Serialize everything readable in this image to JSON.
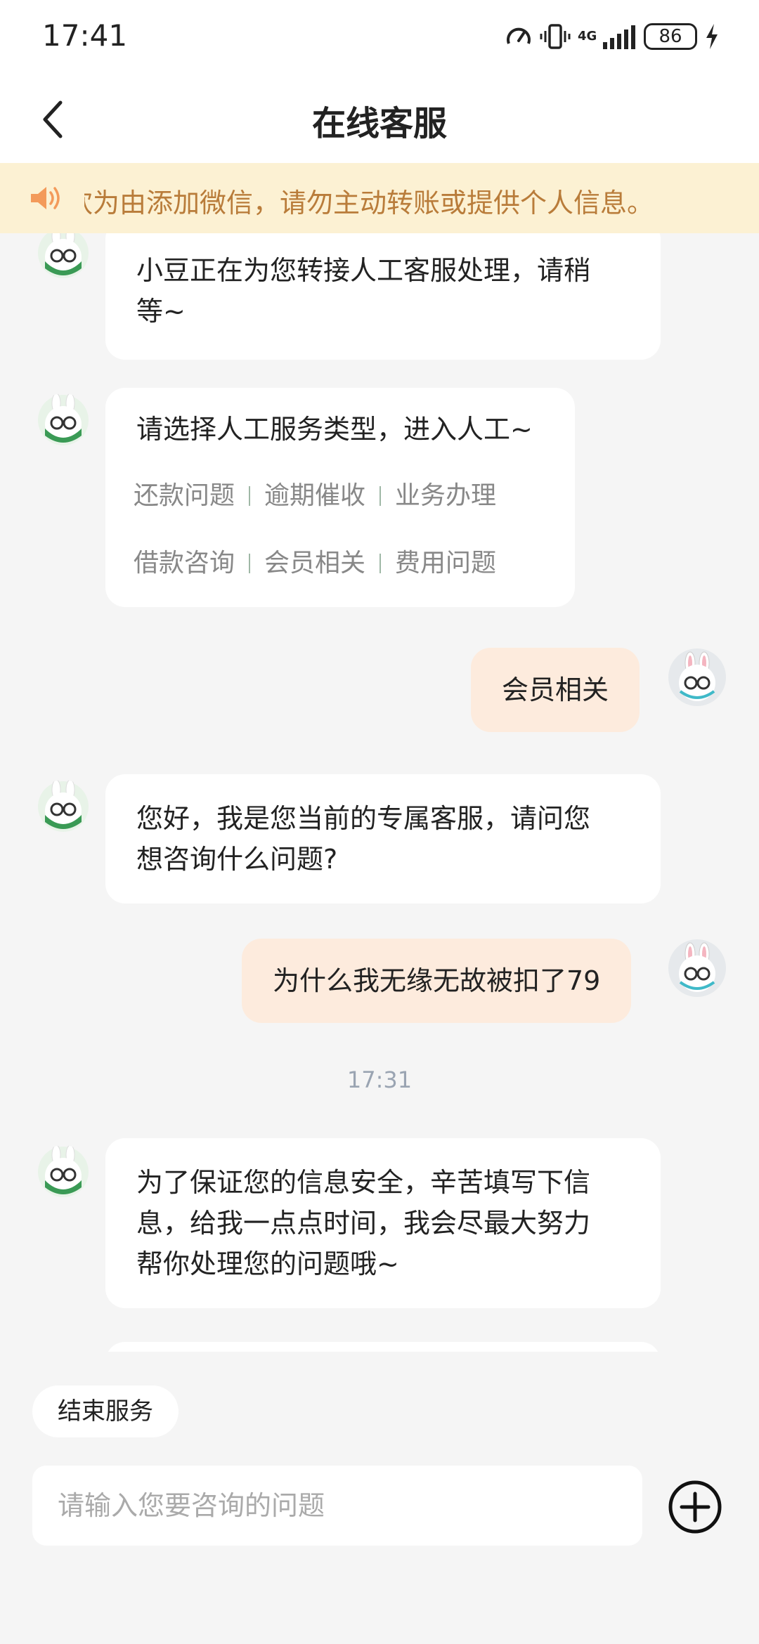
{
  "status_bar": {
    "time": "17:41",
    "battery": "86",
    "network": "4G",
    "icons": [
      "speed-icon",
      "vibrate-icon",
      "signal-icon",
      "battery-icon",
      "charging-icon"
    ]
  },
  "header": {
    "title": "在线客服",
    "back_icon": "chevron-left-icon"
  },
  "notice": {
    "icon": "speaker-icon",
    "text": "欢为由添加微信，请勿主动转账或提供个人信息。"
  },
  "messages": [
    {
      "sender": "agent",
      "text": "小豆正在为您转接人工客服处理，请稍\n等~"
    },
    {
      "sender": "agent",
      "text": "请选择人工服务类型，进入人工~",
      "options": [
        [
          "还款问题",
          "逾期催收",
          "业务办理"
        ],
        [
          "借款咨询",
          "会员相关",
          "费用问题"
        ]
      ]
    },
    {
      "sender": "user",
      "text": "会员相关"
    },
    {
      "sender": "agent",
      "text": "您好，我是您当前的专属客服，请问您\n想咨询什么问题?"
    },
    {
      "sender": "user",
      "text": "为什么我无缘无故被扣了79"
    },
    {
      "timestamp": "17:31"
    },
    {
      "sender": "agent",
      "text": "为了保证您的信息安全，辛苦填写下信\n息，给我一点点时间，我会尽最大努力\n帮你处理您的问题哦~"
    }
  ],
  "footer": {
    "end_service_label": "结束服务",
    "input_placeholder": "请输入您要咨询的问题",
    "plus_icon": "plus-circle-icon"
  },
  "colors": {
    "background": "#f5f5f5",
    "notice_bg": "#fcf1d3",
    "notice_text": "#b97c3a",
    "user_bubble": "#fdebdd",
    "agent_bubble": "#ffffff",
    "option_text": "#888888"
  }
}
